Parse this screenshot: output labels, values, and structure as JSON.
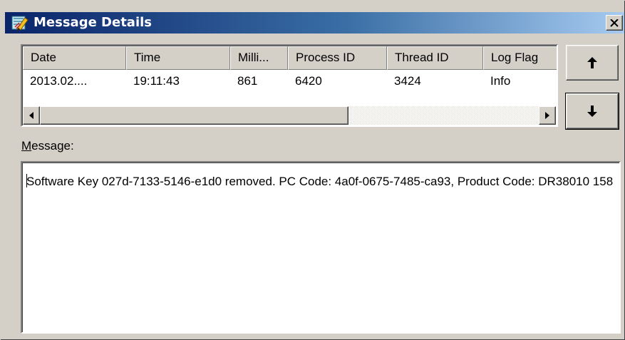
{
  "window": {
    "title": "Message Details",
    "close_icon": "close-icon"
  },
  "columns": [
    "Date",
    "Time",
    "Milli...",
    "Process ID",
    "Thread ID",
    "Log Flag"
  ],
  "rows": [
    [
      "2013.02....",
      "19:11:43",
      "861",
      "6420",
      "3424",
      "Info"
    ]
  ],
  "nav": {
    "up_icon": "arrow-up-icon",
    "down_icon": "arrow-down-icon"
  },
  "message": {
    "label_accel": "M",
    "label_rest": "essage:",
    "text": "Software Key 027d-7133-5146-e1d0 removed. PC Code: 4a0f-0675-7485-ca93, Product Code: DR38010 158"
  },
  "colors": {
    "title_gradient_start": "#0a246a",
    "title_gradient_end": "#a6caf0",
    "face": "#d4d0c8"
  }
}
